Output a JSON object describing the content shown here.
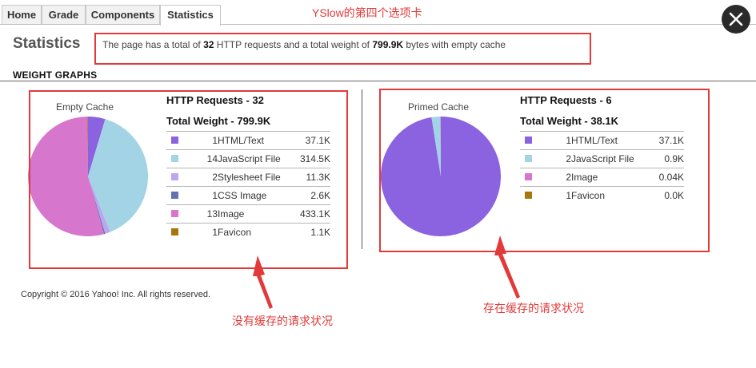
{
  "tabs": [
    {
      "label": "Home"
    },
    {
      "label": "Grade"
    },
    {
      "label": "Components"
    },
    {
      "label": "Statistics",
      "active": true
    }
  ],
  "page_title": "Statistics",
  "summary": {
    "prefix": "The page has a total of ",
    "requests": "32",
    "middle": " HTTP requests and a total weight of ",
    "weight": "799.9K",
    "suffix": " bytes with empty cache"
  },
  "section_title": "WEIGHT GRAPHS",
  "empty_cache": {
    "pie_title": "Empty Cache",
    "requests_header": "HTTP Requests - 32",
    "weight_header": "Total Weight - 799.9K",
    "rows": [
      {
        "count": "1",
        "label": "HTML/Text",
        "value": "37.1K",
        "color": "#8b62df"
      },
      {
        "count": "14",
        "label": "JavaScript File",
        "value": "314.5K",
        "color": "#a3d4e6"
      },
      {
        "count": "2",
        "label": "Stylesheet File",
        "value": "11.3K",
        "color": "#bca7ec"
      },
      {
        "count": "1",
        "label": "CSS Image",
        "value": "2.6K",
        "color": "#6472b0"
      },
      {
        "count": "13",
        "label": "Image",
        "value": "433.1K",
        "color": "#d676cc"
      },
      {
        "count": "1",
        "label": "Favicon",
        "value": "1.1K",
        "color": "#a9760d"
      }
    ]
  },
  "primed_cache": {
    "pie_title": "Primed Cache",
    "requests_header": "HTTP Requests - 6",
    "weight_header": "Total Weight - 38.1K",
    "rows": [
      {
        "count": "1",
        "label": "HTML/Text",
        "value": "37.1K",
        "color": "#8b62df"
      },
      {
        "count": "2",
        "label": "JavaScript File",
        "value": "0.9K",
        "color": "#a3d4e6"
      },
      {
        "count": "2",
        "label": "Image",
        "value": "0.04K",
        "color": "#d676cc"
      },
      {
        "count": "1",
        "label": "Favicon",
        "value": "0.0K",
        "color": "#a9760d"
      }
    ]
  },
  "footer": "Copyright © 2016 Yahoo! Inc. All rights reserved.",
  "annotations": {
    "top_note": "YSlow的第四个选项卡",
    "left_note": "没有缓存的请求状况",
    "right_note": "存在缓存的请求状况",
    "color": "#e23a3a"
  },
  "close_icon": "close-icon"
}
